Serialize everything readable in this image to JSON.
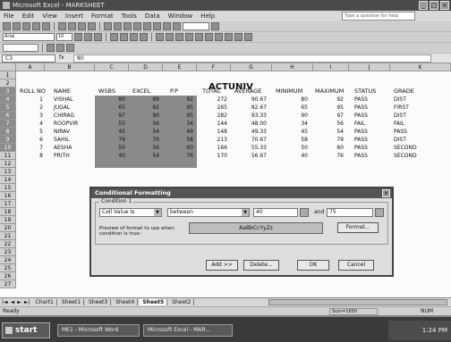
{
  "window": {
    "title": "Microsoft Excel - MARKSHEET"
  },
  "menu": [
    "File",
    "Edit",
    "View",
    "Insert",
    "Format",
    "Tools",
    "Data",
    "Window",
    "Help"
  ],
  "help_box": "Type a question for help",
  "toolbar2": {
    "font": "Arial",
    "size": "10"
  },
  "formula": {
    "namebox": "C3",
    "fx": "fx",
    "value": "80"
  },
  "columns": [
    "A",
    "B",
    "C",
    "D",
    "E",
    "F",
    "G",
    "H",
    "I",
    "J",
    "K"
  ],
  "rows": [
    "1",
    "2",
    "3",
    "4",
    "5",
    "6",
    "7",
    "8",
    "9",
    "10",
    "11",
    "12",
    "13",
    "14",
    "15",
    "16",
    "17",
    "18",
    "19",
    "20",
    "21",
    "22",
    "23",
    "24",
    "25",
    "26",
    "27"
  ],
  "sheet": {
    "title": "ACTUNIV",
    "headers": [
      "ROLL NO",
      "NAME",
      "WSBS",
      "EXCEL",
      "P.P",
      "TOTAL",
      "AVERAGE",
      "MINIMUM",
      "MAXIMUM",
      "STATUS",
      "GRADE"
    ],
    "data": [
      {
        "roll": "1",
        "name": "VISHAL",
        "c": "80",
        "d": "89",
        "e": "92",
        "total": "272",
        "avg": "90.67",
        "min": "80",
        "max": "92",
        "status": "PASS",
        "grade": "DIST"
      },
      {
        "roll": "2",
        "name": "JUGAL",
        "c": "65",
        "d": "82",
        "e": "95",
        "total": "265",
        "avg": "82.67",
        "min": "65",
        "max": "95",
        "status": "PASS",
        "grade": "FIRST"
      },
      {
        "roll": "3",
        "name": "CHIRAG",
        "c": "97",
        "d": "90",
        "e": "95",
        "total": "282",
        "avg": "93.33",
        "min": "90",
        "max": "97",
        "status": "PASS",
        "grade": "DIST"
      },
      {
        "roll": "4",
        "name": "ROOPVIR",
        "c": "55",
        "d": "56",
        "e": "34",
        "total": "144",
        "avg": "48.00",
        "min": "34",
        "max": "56",
        "status": "FAIL",
        "grade": "FAIL"
      },
      {
        "roll": "5",
        "name": "NIRAV",
        "c": "45",
        "d": "54",
        "e": "49",
        "total": "148",
        "avg": "49.33",
        "min": "45",
        "max": "54",
        "status": "PASS",
        "grade": "PASS"
      },
      {
        "roll": "6",
        "name": "SAHIL",
        "c": "79",
        "d": "76",
        "e": "58",
        "total": "213",
        "avg": "70.67",
        "min": "58",
        "max": "79",
        "status": "PASS",
        "grade": "DIST"
      },
      {
        "roll": "7",
        "name": "AESHA",
        "c": "50",
        "d": "56",
        "e": "60",
        "total": "166",
        "avg": "55.33",
        "min": "50",
        "max": "60",
        "status": "PASS",
        "grade": "SECOND"
      },
      {
        "roll": "8",
        "name": "PRITH",
        "c": "40",
        "d": "54",
        "e": "76",
        "total": "170",
        "avg": "56.67",
        "min": "40",
        "max": "76",
        "status": "PASS",
        "grade": "SECOND"
      }
    ]
  },
  "sheet_tabs": [
    "Chart1",
    "Sheet1",
    "Sheet3",
    "Sheet4",
    "Sheet5",
    "Sheet2"
  ],
  "status": {
    "left": "Ready",
    "sum": "Sum=1650",
    "num": "NUM"
  },
  "dialog": {
    "title": "Conditional Formatting",
    "group_label": "Condition 1",
    "condition_type": "Cell Value Is",
    "operator": "between",
    "value1": "40",
    "and_label": "and",
    "value2": "75",
    "preview_label": "Preview of format to use when condition is true:",
    "preview_text": "AaBbCcYyZz",
    "format_btn": "Format...",
    "add_btn": "Add >>",
    "delete_btn": "Delete...",
    "ok_btn": "OK",
    "cancel_btn": "Cancel"
  },
  "taskbar": {
    "start": "start",
    "items": [
      "ME1 - Microsoft Word",
      "Microsoft Excel - MAR..."
    ],
    "clock": "1:24 PM"
  }
}
